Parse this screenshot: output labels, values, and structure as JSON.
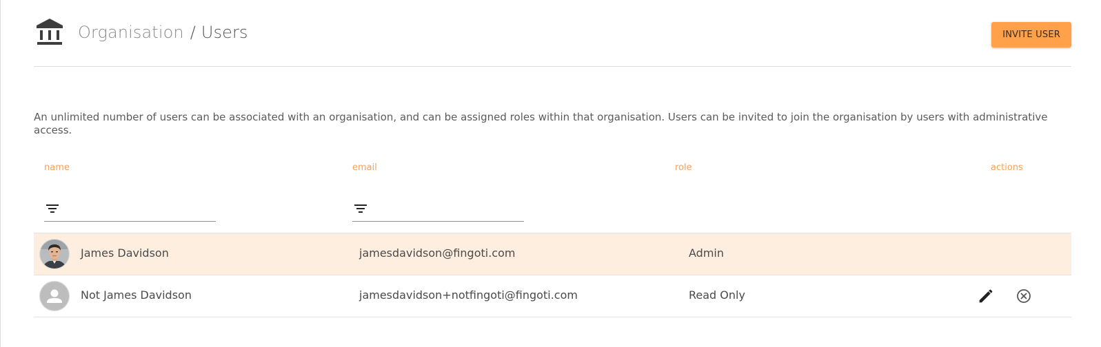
{
  "breadcrumb": {
    "parent": "Organisation",
    "separator": "/",
    "current": "Users"
  },
  "header": {
    "invite_label": "INVITE USER",
    "org_icon": "bank-building-icon"
  },
  "description": "An unlimited number of users can be associated with an organisation, and can be assigned roles within that organisation. Users can be invited to join the organisation by users with administrative access.",
  "table": {
    "columns": {
      "name": "name",
      "email": "email",
      "role": "role",
      "actions": "actions"
    },
    "filters": {
      "name": {
        "value": "",
        "icon": "filter-list-icon"
      },
      "email": {
        "value": "",
        "icon": "filter-list-icon"
      }
    },
    "rows": [
      {
        "name": "James Davidson",
        "email": "jamesdavidson@fingoti.com",
        "role": "Admin",
        "avatar": "user-photo",
        "selected": true,
        "actions": []
      },
      {
        "name": "Not James Davidson",
        "email": "jamesdavidson+notfingoti@fingoti.com",
        "role": "Read Only",
        "avatar": "default-person-icon",
        "selected": false,
        "actions": [
          "edit-pencil-icon",
          "remove-circle-icon"
        ]
      }
    ]
  },
  "colors": {
    "accent": "#ffa04b",
    "header_text": "#f4a15a",
    "selected_row": "#feeee0"
  }
}
